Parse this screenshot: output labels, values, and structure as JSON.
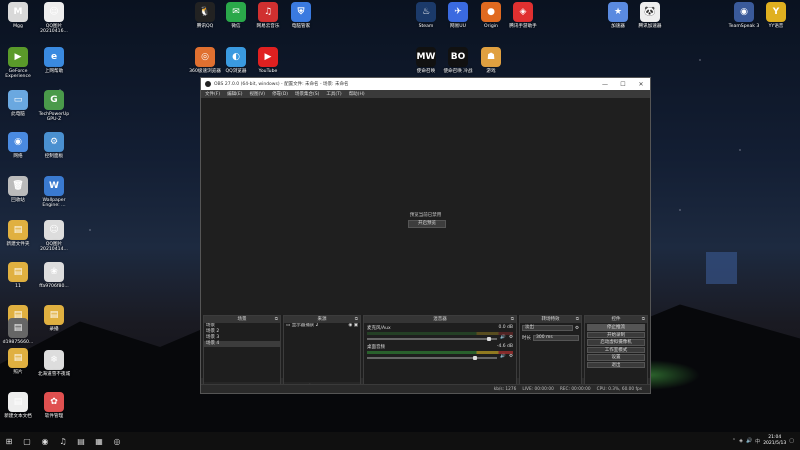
{
  "desktop": {
    "icons": [
      {
        "label": "Mgg",
        "glyph": "M",
        "color": "#d9d9d9"
      },
      {
        "label": "QQ图片20210416...",
        "glyph": "☺",
        "color": "#eee"
      },
      {
        "label": "GeForce Experience",
        "glyph": "▶",
        "color": "#5a9a2a"
      },
      {
        "label": "上网帮助",
        "glyph": "e",
        "color": "#3a8ae0"
      },
      {
        "label": "此电脑",
        "glyph": "▭",
        "color": "#6aa8e0"
      },
      {
        "label": "TechPowerUp GPU-Z",
        "glyph": "G",
        "color": "#4a9a4a"
      },
      {
        "label": "网络",
        "glyph": "◉",
        "color": "#4a8ae0"
      },
      {
        "label": "控制面板",
        "glyph": "⚙",
        "color": "#4a90d0"
      },
      {
        "label": "回收站",
        "glyph": "🗑",
        "color": "#bbb"
      },
      {
        "label": "Wallpaper Engine: ...",
        "glyph": "W",
        "color": "#3a7ad0"
      },
      {
        "label": "新建文件夹",
        "glyph": "▤",
        "color": "#e0b040"
      },
      {
        "label": "QQ图片20210414...",
        "glyph": "☺",
        "color": "#ddd"
      },
      {
        "label": "11",
        "glyph": "▤",
        "color": "#e0b040"
      },
      {
        "label": "ffa9706f80...",
        "glyph": "❀",
        "color": "#ddd"
      },
      {
        "label": "汪眩",
        "glyph": "▤",
        "color": "#e0b040"
      },
      {
        "label": "d19875660...",
        "glyph": "▤",
        "color": "#666"
      },
      {
        "label": "录播",
        "glyph": "▤",
        "color": "#e0b040"
      },
      {
        "label": "照片",
        "glyph": "▤",
        "color": "#e0b040"
      },
      {
        "label": "北海道雪不夜城",
        "glyph": "❄",
        "color": "#ddd"
      },
      {
        "label": "新建文本文档",
        "glyph": "▤",
        "color": "#eee"
      },
      {
        "label": "软件管理",
        "glyph": "✿",
        "color": "#e05050"
      },
      {
        "label": "腾讯QQ",
        "glyph": "🐧",
        "color": "#222"
      },
      {
        "label": "微信",
        "glyph": "✉",
        "color": "#2aa84a"
      },
      {
        "label": "网易云音乐",
        "glyph": "♫",
        "color": "#d03030"
      },
      {
        "label": "电脑管家",
        "glyph": "⛨",
        "color": "#3a7ae0"
      },
      {
        "label": "360极速浏览器",
        "glyph": "◎",
        "color": "#e07030"
      },
      {
        "label": "QQ浏览器",
        "glyph": "◐",
        "color": "#3a9ae0"
      },
      {
        "label": "YouTube",
        "glyph": "▶",
        "color": "#e02020"
      },
      {
        "label": "Steam",
        "glyph": "♨",
        "color": "#1b3a6a"
      },
      {
        "label": "网易UU",
        "glyph": "✈",
        "color": "#3a6ae0"
      },
      {
        "label": "Origin",
        "glyph": "●",
        "color": "#e06a20"
      },
      {
        "label": "腾讯手游助手",
        "glyph": "◈",
        "color": "#e03030"
      },
      {
        "label": "加速器",
        "glyph": "★",
        "color": "#5a8ae0"
      },
      {
        "label": "腾讯加速器",
        "glyph": "🐼",
        "color": "#eee"
      },
      {
        "label": "TeamSpeak 3",
        "glyph": "◉",
        "color": "#3a5a9a"
      },
      {
        "label": "YY语音",
        "glyph": "Y",
        "color": "#e0b020"
      },
      {
        "label": "使命召唤",
        "glyph": "MW",
        "color": "#111"
      },
      {
        "label": "使命召唤 冷战",
        "glyph": "BO",
        "color": "#111"
      },
      {
        "label": "游戏",
        "glyph": "☗",
        "color": "#e0a040"
      }
    ]
  },
  "obs": {
    "title": "OBS 27.0.0 (64-bit, windows) - 配置文件: 未命名 - 场景: 未命名",
    "window_controls": [
      "—",
      "☐",
      "✕"
    ],
    "menu": [
      "文件(F)",
      "编辑(E)",
      "视图(V)",
      "停靠(D)",
      "场景集合(S)",
      "工具(T)",
      "帮助(H)"
    ],
    "preview_message": "预览当前已禁用",
    "preview_button": "开启预览",
    "scene_label": "未选择源",
    "audio_toggles": [
      "属性",
      "滤镜"
    ],
    "docks": {
      "scenes": {
        "title": "场景",
        "items": [
          "场景",
          "场景 2",
          "场景 3",
          "场景 4"
        ],
        "selected": 3
      },
      "sources": {
        "title": "来源",
        "items": [
          "显示器捕获 2"
        ]
      },
      "mixer": {
        "title": "混音器",
        "tracks": [
          {
            "name": "麦克风/Aux",
            "db": "0.0 dB"
          },
          {
            "name": "桌面音频",
            "db": "-4.6 dB"
          }
        ]
      },
      "transitions": {
        "title": "转场特效",
        "type": "淡出",
        "duration_label": "时长",
        "duration": "300 ms"
      },
      "controls": {
        "title": "控件",
        "buttons": [
          "停止推流",
          "开始录制",
          "启动虚拟摄像机",
          "工作室模式",
          "设置",
          "退出"
        ]
      }
    },
    "status": {
      "dropped": "丢帧 0 (0.0%)",
      "live": "LIVE: 00:00:00",
      "rec": "REC: 00:00:00",
      "cpu": "CPU: 0.3%, 60.00 fps",
      "bitrate": "kb/s: 1276"
    }
  },
  "taskbar": {
    "time": "21:04",
    "date": "2021/5/13",
    "apps": [
      "⊞",
      "▢",
      "◉",
      "♫",
      "▤",
      "▦",
      "◎"
    ]
  }
}
